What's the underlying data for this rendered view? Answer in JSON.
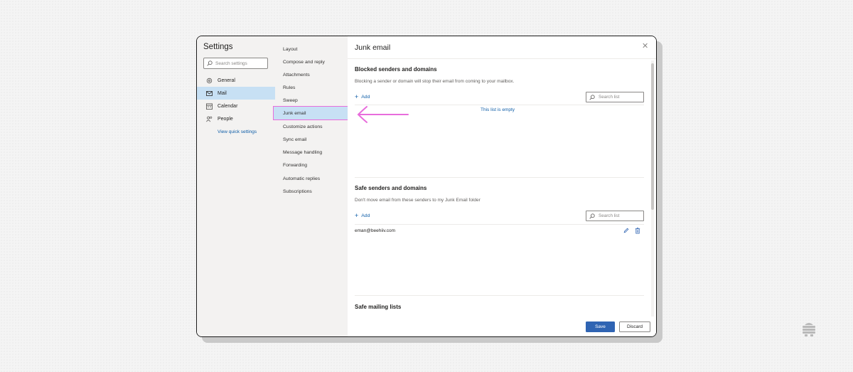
{
  "settings": {
    "title": "Settings",
    "search_placeholder": "Search settings",
    "categories": [
      {
        "label": "General",
        "icon": "gear-icon"
      },
      {
        "label": "Mail",
        "icon": "mail-icon",
        "active": true
      },
      {
        "label": "Calendar",
        "icon": "calendar-icon"
      },
      {
        "label": "People",
        "icon": "people-icon"
      }
    ],
    "quick_settings_link": "View quick settings"
  },
  "mail_menu": {
    "items": [
      "Layout",
      "Compose and reply",
      "Attachments",
      "Rules",
      "Sweep",
      "Junk email",
      "Customize actions",
      "Sync email",
      "Message handling",
      "Forwarding",
      "Automatic replies",
      "Subscriptions"
    ],
    "active_index": 5
  },
  "junk": {
    "title": "Junk email",
    "blocked": {
      "title": "Blocked senders and domains",
      "description": "Blocking a sender or domain will stop their email from coming to your mailbox.",
      "add_label": "Add",
      "search_placeholder": "Search list",
      "empty_message": "This list is empty"
    },
    "safe": {
      "title": "Safe senders and domains",
      "description": "Don't move email from these senders to my Junk Email folder",
      "add_label": "Add",
      "search_placeholder": "Search list",
      "entries": [
        "eman@beehiiv.com"
      ]
    },
    "mailing": {
      "title": "Safe mailing lists"
    },
    "save_label": "Save",
    "discard_label": "Discard"
  },
  "colors": {
    "accent": "#2f64b3",
    "selection": "#c7e0f4",
    "annotation": "#e86ddc"
  }
}
